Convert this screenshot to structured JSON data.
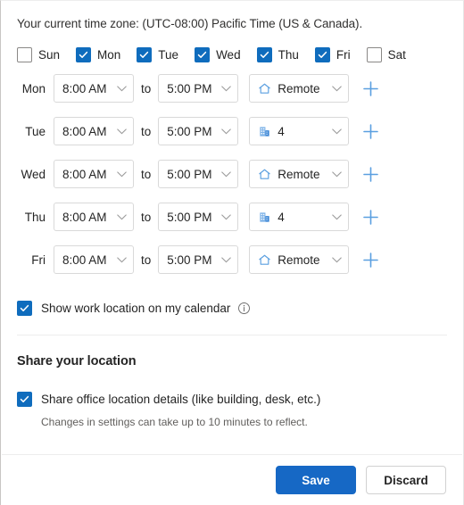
{
  "timezone_line": "Your current time zone: (UTC-08:00) Pacific Time (US & Canada).",
  "accent_color": "#0f6cbd",
  "save_button_color": "#1668c5",
  "day_checkboxes": [
    {
      "label": "Sun",
      "checked": false
    },
    {
      "label": "Mon",
      "checked": true
    },
    {
      "label": "Tue",
      "checked": true
    },
    {
      "label": "Wed",
      "checked": true
    },
    {
      "label": "Thu",
      "checked": true
    },
    {
      "label": "Fri",
      "checked": true
    },
    {
      "label": "Sat",
      "checked": false
    }
  ],
  "to_label": "to",
  "schedule": [
    {
      "day": "Mon",
      "start": "8:00 AM",
      "end": "5:00 PM",
      "location": "Remote",
      "location_icon": "home-icon"
    },
    {
      "day": "Tue",
      "start": "8:00 AM",
      "end": "5:00 PM",
      "location": "4",
      "location_icon": "building-icon"
    },
    {
      "day": "Wed",
      "start": "8:00 AM",
      "end": "5:00 PM",
      "location": "Remote",
      "location_icon": "home-icon"
    },
    {
      "day": "Thu",
      "start": "8:00 AM",
      "end": "5:00 PM",
      "location": "4",
      "location_icon": "building-icon"
    },
    {
      "day": "Fri",
      "start": "8:00 AM",
      "end": "5:00 PM",
      "location": "Remote",
      "location_icon": "home-icon"
    }
  ],
  "show_work_location": {
    "label": "Show work location on my calendar",
    "checked": true,
    "info_icon": "info-icon"
  },
  "share_section": {
    "title": "Share your location",
    "checkbox_label": "Share office location details (like building, desk, etc.)",
    "checked": true,
    "note": "Changes in settings can take up to 10 minutes to reflect."
  },
  "footer": {
    "save_label": "Save",
    "discard_label": "Discard"
  }
}
